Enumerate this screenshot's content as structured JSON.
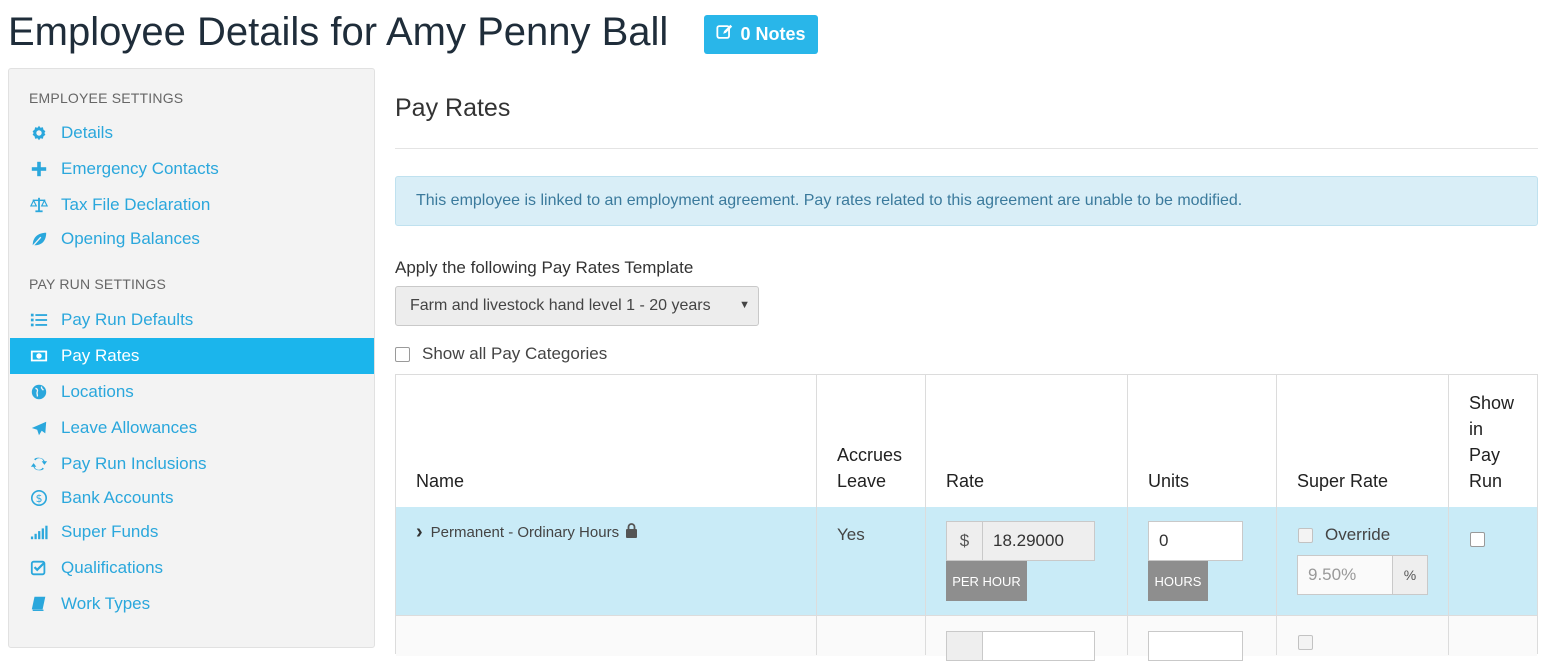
{
  "header": {
    "title": "Employee Details for Amy Penny Ball",
    "notes_label": "0 Notes"
  },
  "sidebar": {
    "sections": [
      {
        "title": "EMPLOYEE SETTINGS",
        "items": [
          {
            "label": "Details",
            "icon": "gear-icon"
          },
          {
            "label": "Emergency Contacts",
            "icon": "plus-icon"
          },
          {
            "label": "Tax File Declaration",
            "icon": "scale-icon"
          },
          {
            "label": "Opening Balances",
            "icon": "leaf-icon"
          }
        ]
      },
      {
        "title": "PAY RUN SETTINGS",
        "items": [
          {
            "label": "Pay Run Defaults",
            "icon": "list-icon"
          },
          {
            "label": "Pay Rates",
            "icon": "money-icon",
            "active": true
          },
          {
            "label": "Locations",
            "icon": "globe-icon"
          },
          {
            "label": "Leave Allowances",
            "icon": "plane-icon"
          },
          {
            "label": "Pay Run Inclusions",
            "icon": "refresh-icon"
          },
          {
            "label": "Bank Accounts",
            "icon": "dollar-circle-icon"
          },
          {
            "label": "Super Funds",
            "icon": "signal-icon"
          },
          {
            "label": "Qualifications",
            "icon": "checkbox-icon"
          },
          {
            "label": "Work Types",
            "icon": "book-icon"
          }
        ]
      }
    ]
  },
  "main": {
    "heading": "Pay Rates",
    "alert": "This employee is linked to an employment agreement. Pay rates related to this agreement are unable to be modified.",
    "template_label": "Apply the following Pay Rates Template",
    "template_selected": "Farm and livestock hand level 1 - 20 years",
    "show_all_label": "Show all Pay Categories",
    "table": {
      "headers": {
        "name": "Name",
        "accrues_leave": [
          "Accrues",
          "Leave"
        ],
        "rate": "Rate",
        "units": "Units",
        "super_rate": "Super Rate",
        "show_in_pay_run": [
          "Show",
          "in",
          "Pay",
          "Run"
        ]
      },
      "rows": [
        {
          "name": "Permanent - Ordinary Hours",
          "accrues_leave": "Yes",
          "rate_prefix": "$",
          "rate": "18.29000",
          "rate_unit": "PER HOUR",
          "units": "0",
          "units_unit": "HOURS",
          "override_label": "Override",
          "super_rate": "9.50%",
          "super_suffix": "%"
        }
      ]
    }
  },
  "colors": {
    "accent": "#1bb5ec",
    "link": "#2aa7dc",
    "row_highlight": "#c9ebf7",
    "alert_bg": "#d9eef7"
  }
}
